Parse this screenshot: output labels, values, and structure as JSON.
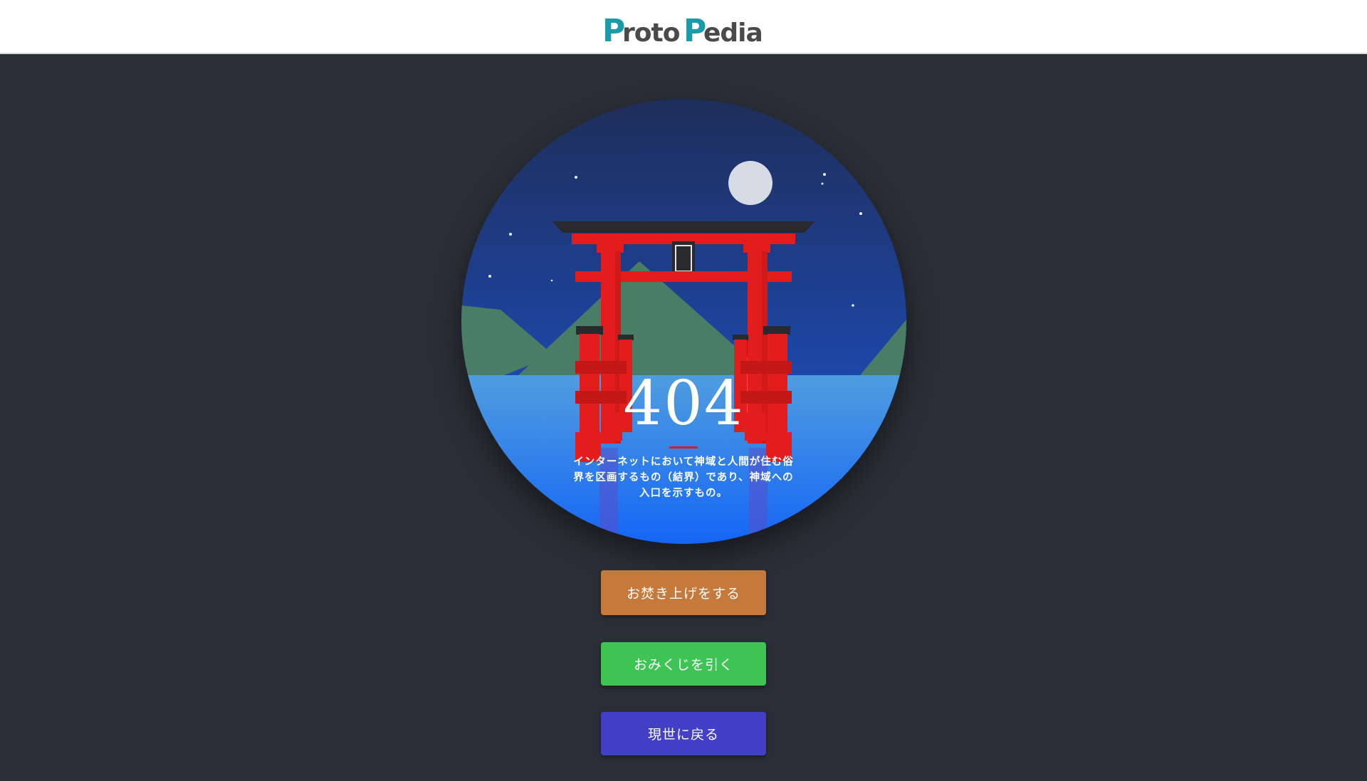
{
  "header": {
    "logo_text": "Proto Pedia",
    "colors": {
      "proto": "#1d9aa8",
      "pedia": "#4a4a4a"
    }
  },
  "hero": {
    "error_code": "404",
    "shrine_plaque_glyph": "\u0000",
    "message": "インターネットにおいて神域と人間が住む俗界を区画するもの（結界）であり、神域への入口を示すもの。",
    "illustration": "torii-gate-at-night-icon",
    "colors": {
      "sky_top": "#1e2e5a",
      "sky_bottom": "#1d47a8",
      "water_top": "#4f9ddf",
      "water_bottom": "#1565f5",
      "mountains": "#4a7d66",
      "torii": "#e31c1c",
      "moon": "#d6dbe6"
    }
  },
  "actions": {
    "burn_label": "お焚き上げをする",
    "omikuji_label": "おみくじを引く",
    "return_label": "現世に戻る",
    "colors": {
      "burn": "#c57a3c",
      "omikuji": "#3ec454",
      "return": "#4440c6"
    }
  }
}
